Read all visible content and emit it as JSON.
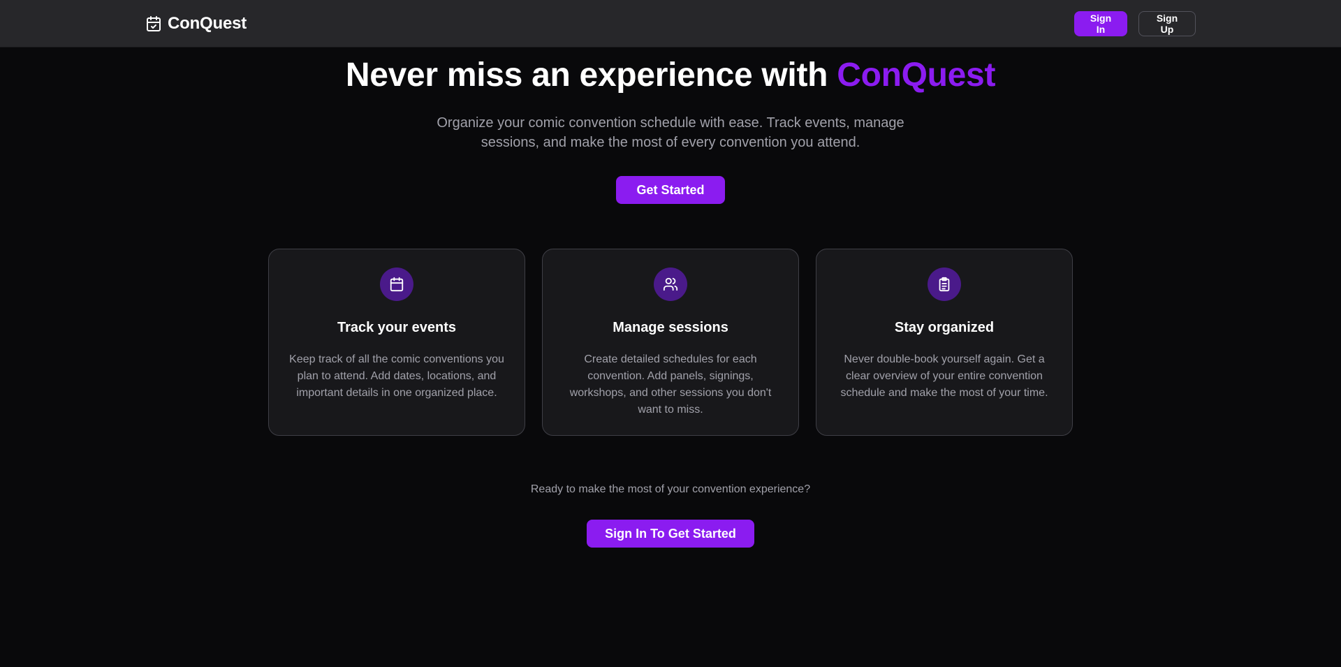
{
  "header": {
    "brand": "ConQuest",
    "sign_in": "Sign In",
    "sign_up": "Sign Up"
  },
  "hero": {
    "title_prefix": "Never miss an experience with ",
    "title_accent": "ConQuest",
    "subtitle": "Organize your comic convention schedule with ease. Track events, manage sessions, and make the most of every convention you attend.",
    "cta": "Get Started"
  },
  "features": [
    {
      "icon": "calendar-icon",
      "title": "Track your events",
      "text": "Keep track of all the comic conventions you plan to attend. Add dates, locations, and important details in one organized place."
    },
    {
      "icon": "users-icon",
      "title": "Manage sessions",
      "text": "Create detailed schedules for each convention. Add panels, signings, workshops, and other sessions you don't want to miss."
    },
    {
      "icon": "clipboard-icon",
      "title": "Stay organized",
      "text": "Never double-book yourself again. Get a clear overview of your entire convention schedule and make the most of your time."
    }
  ],
  "footer_cta": {
    "text": "Ready to make the most of your convention experience?",
    "button": "Sign In To Get Started"
  },
  "colors": {
    "accent": "#8b1cf0",
    "background": "#09090b",
    "navbar": "#27272a",
    "card": "#18181b"
  }
}
